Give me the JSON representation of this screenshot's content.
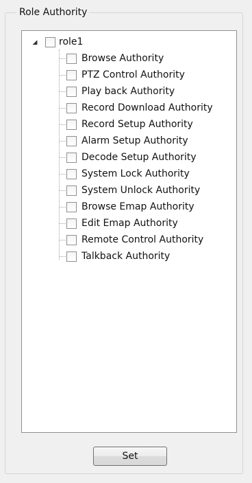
{
  "group": {
    "title": "Role Authority"
  },
  "tree": {
    "root": {
      "label": "role1",
      "expander_icon": "expanded-triangle-icon",
      "checked": false
    },
    "children": [
      {
        "label": "Browse Authority",
        "checked": false
      },
      {
        "label": "PTZ Control Authority",
        "checked": false
      },
      {
        "label": "Play back Authority",
        "checked": false
      },
      {
        "label": "Record Download Authority",
        "checked": false
      },
      {
        "label": "Record Setup Authority",
        "checked": false
      },
      {
        "label": "Alarm Setup Authority",
        "checked": false
      },
      {
        "label": "Decode Setup Authority",
        "checked": false
      },
      {
        "label": "System Lock Authority",
        "checked": false
      },
      {
        "label": "System Unlock Authority",
        "checked": false
      },
      {
        "label": "Browse Emap Authority",
        "checked": false
      },
      {
        "label": "Edit Emap Authority",
        "checked": false
      },
      {
        "label": "Remote Control Authority",
        "checked": false
      },
      {
        "label": "Talkback Authority",
        "checked": false
      }
    ]
  },
  "actions": {
    "set_label": "Set"
  }
}
